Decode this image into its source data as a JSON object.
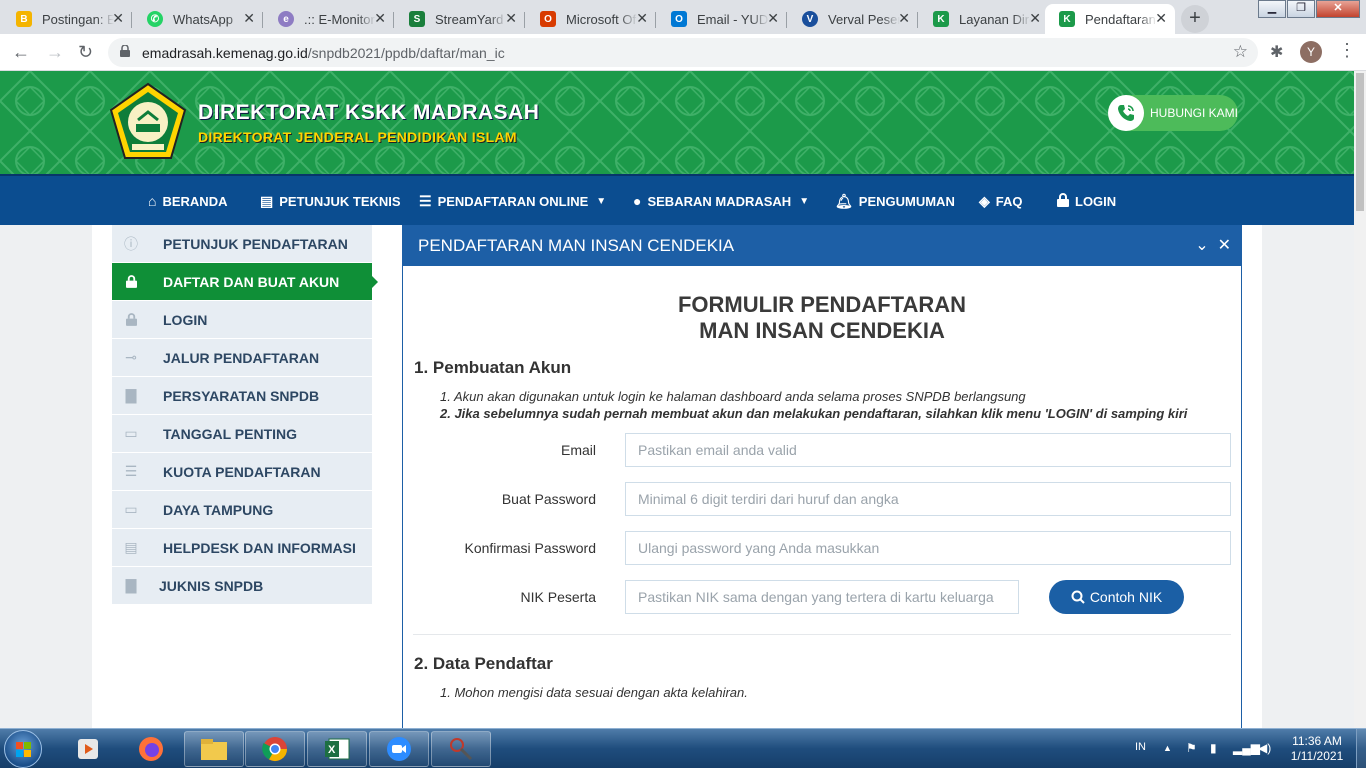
{
  "browser": {
    "tabs": [
      {
        "label": "Postingan: E",
        "color": "#f4b400",
        "glyph": "B"
      },
      {
        "label": "WhatsApp",
        "color": "#25d366",
        "glyph": "W"
      },
      {
        "label": ".:: E-Monitor",
        "color": "#8e7cc3",
        "glyph": "e"
      },
      {
        "label": "StreamYard",
        "color": "#1a7f3c",
        "glyph": "S"
      },
      {
        "label": "Microsoft Of",
        "color": "#d83b01",
        "glyph": "O"
      },
      {
        "label": "Email - YUDI",
        "color": "#0078d4",
        "glyph": "O"
      },
      {
        "label": "Verval Peser",
        "color": "#1a4f9c",
        "glyph": "V"
      },
      {
        "label": "Layanan Dire",
        "color": "#1c9a4a",
        "glyph": "K"
      },
      {
        "label": "Pendaftaran",
        "color": "#1c9a4a",
        "glyph": "K"
      }
    ],
    "url_host": "emadrasah.kemenag.go.id",
    "url_path": "/snpdb2021/ppdb/daftar/man_ic",
    "profile_initial": "Y"
  },
  "header": {
    "brand_title": "DIREKTORAT KSKK MADRASAH",
    "brand_subtitle": "DIREKTORAT JENDERAL PENDIDIKAN ISLAM",
    "contact_label": "HUBUNGI KAMI"
  },
  "nav": {
    "items": [
      {
        "label": "BERANDA"
      },
      {
        "label": "PETUNJUK TEKNIS"
      },
      {
        "label": "PENDAFTARAN ONLINE"
      },
      {
        "label": "SEBARAN MADRASAH"
      },
      {
        "label": "PENGUMUMAN"
      },
      {
        "label": "FAQ"
      },
      {
        "label": "LOGIN"
      }
    ]
  },
  "sidebar": {
    "items": [
      {
        "label": "PETUNJUK PENDAFTARAN"
      },
      {
        "label": "DAFTAR DAN BUAT AKUN"
      },
      {
        "label": "LOGIN"
      },
      {
        "label": "JALUR PENDAFTARAN"
      },
      {
        "label": "PERSYARATAN SNPDB"
      },
      {
        "label": "TANGGAL PENTING"
      },
      {
        "label": "KUOTA PENDAFTARAN"
      },
      {
        "label": "DAYA TAMPUNG"
      },
      {
        "label": "HELPDESK DAN INFORMASI"
      },
      {
        "label": "JUKNIS SNPDB"
      }
    ]
  },
  "panel": {
    "title": "PENDAFTARAN MAN INSAN CENDEKIA",
    "form_title_1": "FORMULIR PENDAFTARAN",
    "form_title_2": "MAN INSAN CENDEKIA",
    "section1": "1. Pembuatan Akun",
    "note1": "1. Akun akan digunakan untuk login ke halaman dashboard anda selama proses SNPDB berlangsung",
    "note2": "2. Jika sebelumnya sudah pernah membuat akun dan melakukan pendaftaran, silahkan klik menu 'LOGIN' di samping kiri",
    "fields": {
      "email_label": "Email",
      "email_placeholder": "Pastikan email anda valid",
      "password_label": "Buat Password",
      "password_placeholder": "Minimal 6 digit terdiri dari huruf dan angka",
      "confirm_label": "Konfirmasi Password",
      "confirm_placeholder": "Ulangi password yang Anda masukkan",
      "nik_label": "NIK Peserta",
      "nik_placeholder": "Pastikan NIK sama dengan yang tertera di kartu keluarga",
      "nik_button": "Contoh NIK"
    },
    "section2": "2. Data Pendaftar",
    "note3": "1. Mohon mengisi data sesuai dengan akta kelahiran."
  },
  "taskbar": {
    "language": "IN",
    "time": "11:36 AM",
    "date": "1/11/2021"
  }
}
